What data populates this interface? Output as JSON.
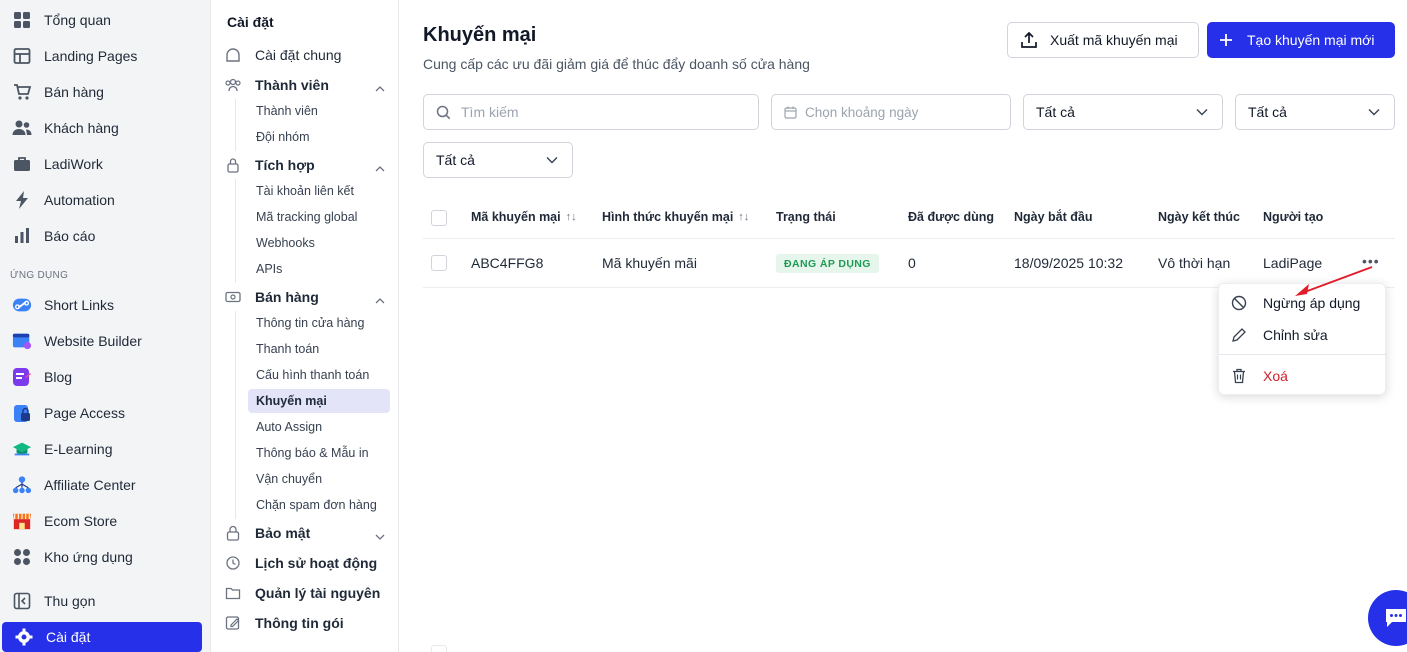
{
  "nav": {
    "items": [
      {
        "label": "Tổng quan",
        "icon": "dashboard-icon"
      },
      {
        "label": "Landing Pages",
        "icon": "layout-icon"
      },
      {
        "label": "Bán hàng",
        "icon": "cart-icon"
      },
      {
        "label": "Khách hàng",
        "icon": "users-icon"
      },
      {
        "label": "LadiWork",
        "icon": "briefcase-icon"
      },
      {
        "label": "Automation",
        "icon": "lightning-icon"
      },
      {
        "label": "Báo cáo",
        "icon": "bar-chart-icon"
      }
    ],
    "apps_section": "ỨNG DỤNG",
    "apps": [
      {
        "label": "Short Links",
        "icon": "link-icon"
      },
      {
        "label": "Website Builder",
        "icon": "website-icon"
      },
      {
        "label": "Blog",
        "icon": "blog-icon"
      },
      {
        "label": "Page Access",
        "icon": "lock-icon"
      },
      {
        "label": "E-Learning",
        "icon": "graduation-icon"
      },
      {
        "label": "Affiliate Center",
        "icon": "network-icon"
      },
      {
        "label": "Ecom Store",
        "icon": "store-icon"
      },
      {
        "label": "Kho ứng dụng",
        "icon": "apps-icon"
      }
    ],
    "collapse": "Thu gọn",
    "settings": "Cài đặt"
  },
  "settings_menu": {
    "title": "Cài đặt",
    "general": "Cài đặt chung",
    "members": {
      "label": "Thành viên",
      "children": [
        "Thành viên",
        "Đội nhóm"
      ]
    },
    "integration": {
      "label": "Tích hợp",
      "children": [
        "Tài khoản liên kết",
        "Mã tracking global",
        "Webhooks",
        "APIs"
      ]
    },
    "sales": {
      "label": "Bán hàng",
      "children": [
        "Thông tin cửa hàng",
        "Thanh toán",
        "Cấu hình thanh toán",
        "Khuyến mại",
        "Auto Assign",
        "Thông báo & Mẫu in",
        "Vận chuyển",
        "Chặn spam đơn hàng"
      ]
    },
    "security": "Bảo mật",
    "history": "Lịch sử hoạt động",
    "resources": "Quản lý tài nguyên",
    "plan": "Thông tin gói"
  },
  "header": {
    "title": "Khuyến mại",
    "subtitle": "Cung cấp các ưu đãi giảm giá để thúc đẩy doanh số cửa hàng",
    "export_label": "Xuất mã khuyến mại",
    "create_label": "Tạo khuyến mại mới"
  },
  "filters": {
    "search_placeholder": "Tìm kiếm",
    "date_placeholder": "Chọn khoảng ngày",
    "select1": "Tất cả",
    "select2": "Tất cả",
    "select3": "Tất cả"
  },
  "table": {
    "columns": [
      "Mã khuyến mại",
      "Hình thức khuyến mại",
      "Trạng thái",
      "Đã được dùng",
      "Ngày bắt đầu",
      "Ngày kết thúc",
      "Người tạo"
    ],
    "rows": [
      {
        "code": "ABC4FFG8",
        "type": "Mã khuyến mãi",
        "status": "ĐANG ÁP DỤNG",
        "used": "0",
        "start": "18/09/2025 10:32",
        "end": "Vô thời hạn",
        "creator": "LadiPage"
      }
    ]
  },
  "row_menu": {
    "stop": "Ngừng áp dụng",
    "edit": "Chỉnh sửa",
    "delete": "Xoá"
  },
  "colors": {
    "primary": "#2530e8",
    "danger": "#d11f2a",
    "success": "#1f9a55"
  }
}
